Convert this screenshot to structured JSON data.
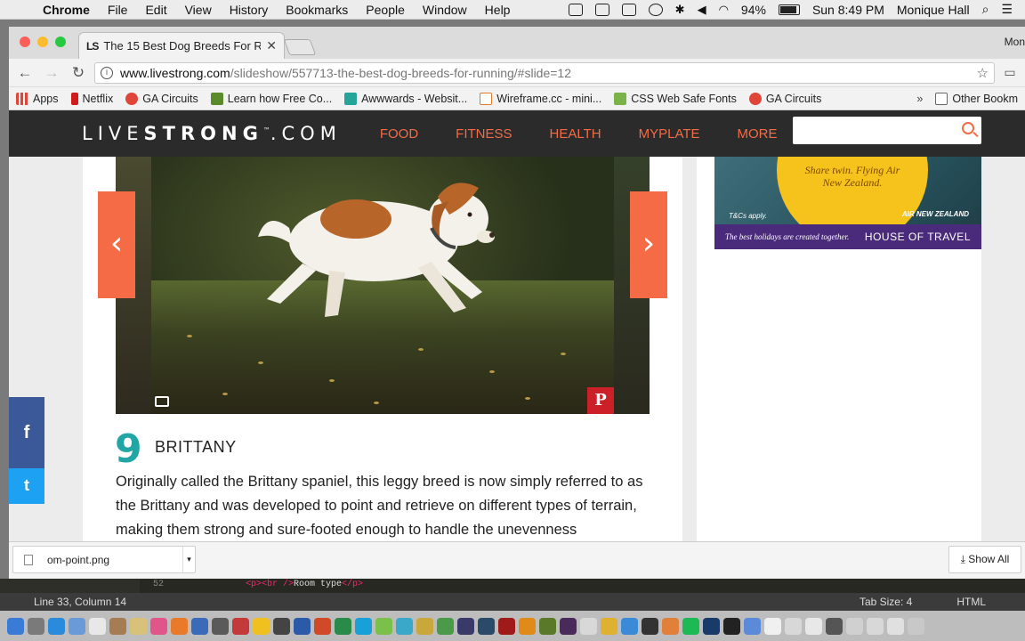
{
  "menubar": {
    "app": "Chrome",
    "items": [
      "File",
      "Edit",
      "View",
      "History",
      "Bookmarks",
      "People",
      "Window",
      "Help"
    ],
    "battery": "94%",
    "clock": "Sun 8:49 PM",
    "user": "Monique Hall"
  },
  "browser": {
    "tab": {
      "favicon": "LS",
      "title": "The 15 Best Dog Breeds For R"
    },
    "profile": "Mon",
    "url": {
      "host": "www.livestrong.com",
      "path": "/slideshow/557713-the-best-dog-breeds-for-running/#slide=12"
    },
    "bookmarks": [
      {
        "label": "Apps",
        "color": "#e0453a"
      },
      {
        "label": "Netflix",
        "color": "#d11a1a"
      },
      {
        "label": "GA Circuits",
        "color": "#e0453a"
      },
      {
        "label": "Learn how Free Co...",
        "color": "#5a8a2a"
      },
      {
        "label": "Awwwards - Websit...",
        "color": "#25a59a"
      },
      {
        "label": "Wireframe.cc - mini...",
        "color": "#e07a2a"
      },
      {
        "label": "CSS Web Safe Fonts",
        "color": "#7ab34a"
      },
      {
        "label": "GA Circuits",
        "color": "#e0453a"
      }
    ],
    "bookmarks_more": "»",
    "other_bookmarks": "Other Bookm"
  },
  "site": {
    "logo_thin1": "LIVE",
    "logo_bold": "STRONG",
    "logo_thin2": ".COM",
    "logo_tm": "™",
    "nav": [
      "FOOD",
      "FITNESS",
      "HEALTH",
      "MYPLATE",
      "MORE"
    ],
    "slide_number": "9",
    "slide_title": "BRITTANY",
    "slide_text": "Originally called the Brittany spaniel, this leggy breed is now simply referred to as the Brittany and was developed to point and retrieve on different types of terrain, making them strong and sure-footed enough to handle the unevenness",
    "prev": "‹",
    "next": "›",
    "pinterest": "P",
    "share_fb": "f",
    "share_tw": "t",
    "ad": {
      "tagline": "Share twin. Flying Air New Zealand.",
      "tc": "T&Cs apply.",
      "airline": "AIR NEW ZEALAND",
      "footer": "The best holidays are created together.",
      "brand": "HOUSE OF TRAVEL"
    }
  },
  "download": {
    "file": "om-point.png",
    "show_all": "Show All"
  },
  "editor": {
    "line_no": "52",
    "code_open": "<p><br />",
    "code_text": "Room type",
    "code_close": "</p>",
    "status": "Line 33, Column 14",
    "tabsize": "Tab Size: 4",
    "syntax": "HTML"
  },
  "accent": "#f46b45",
  "teal": "#22a5a5"
}
